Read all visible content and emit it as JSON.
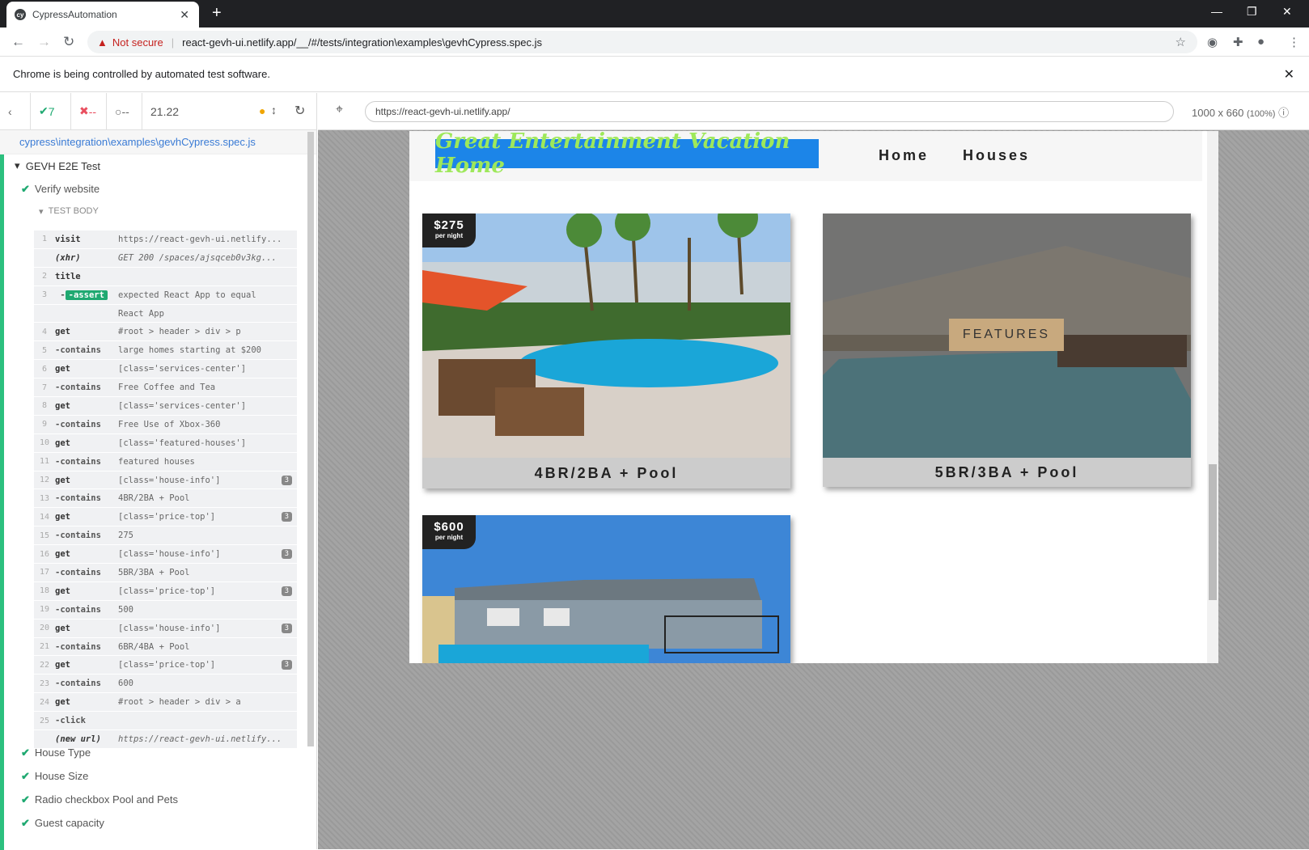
{
  "browser": {
    "tab_title": "CypressAutomation",
    "not_secure": "Not secure",
    "url": "react-gevh-ui.netlify.app/__/#/tests/integration\\examples\\gevhCypress.spec.js",
    "infobar_text": "Chrome is being controlled by automated test software."
  },
  "runner": {
    "passed": "7",
    "failed": "--",
    "pending": "--",
    "duration": "21.22",
    "spec_path": "cypress\\integration\\examples\\gevhCypress.spec.js",
    "suite_title": "GEVH E2E Test",
    "active_test": "Verify website",
    "test_body_label": "TEST BODY",
    "commands": [
      {
        "num": "1",
        "name": "visit",
        "msg": "https://react-gevh-ui.netlify..."
      },
      {
        "num": "",
        "name": "(xhr)",
        "msg": "GET 200 /spaces/ajsqceb0v3kg..."
      },
      {
        "num": "2",
        "name": "title",
        "msg": ""
      },
      {
        "num": "3",
        "name": "-assert",
        "msg": "expected React App to equal"
      },
      {
        "num": "",
        "name": "",
        "msg": "React App"
      },
      {
        "num": "4",
        "name": "get",
        "msg": "#root > header > div > p"
      },
      {
        "num": "5",
        "name": "-contains",
        "msg": "large homes starting at $200"
      },
      {
        "num": "6",
        "name": "get",
        "msg": "[class='services-center']"
      },
      {
        "num": "7",
        "name": "-contains",
        "msg": "Free Coffee and Tea"
      },
      {
        "num": "8",
        "name": "get",
        "msg": "[class='services-center']"
      },
      {
        "num": "9",
        "name": "-contains",
        "msg": "Free Use of Xbox-360"
      },
      {
        "num": "10",
        "name": "get",
        "msg": "[class='featured-houses']"
      },
      {
        "num": "11",
        "name": "-contains",
        "msg": "featured houses"
      },
      {
        "num": "12",
        "name": "get",
        "msg": "[class='house-info']",
        "badge": "3"
      },
      {
        "num": "13",
        "name": "-contains",
        "msg": "4BR/2BA + Pool"
      },
      {
        "num": "14",
        "name": "get",
        "msg": "[class='price-top']",
        "badge": "3"
      },
      {
        "num": "15",
        "name": "-contains",
        "msg": "275"
      },
      {
        "num": "16",
        "name": "get",
        "msg": "[class='house-info']",
        "badge": "3"
      },
      {
        "num": "17",
        "name": "-contains",
        "msg": "5BR/3BA + Pool"
      },
      {
        "num": "18",
        "name": "get",
        "msg": "[class='price-top']",
        "badge": "3"
      },
      {
        "num": "19",
        "name": "-contains",
        "msg": "500"
      },
      {
        "num": "20",
        "name": "get",
        "msg": "[class='house-info']",
        "badge": "3"
      },
      {
        "num": "21",
        "name": "-contains",
        "msg": "6BR/4BA + Pool"
      },
      {
        "num": "22",
        "name": "get",
        "msg": "[class='price-top']",
        "badge": "3"
      },
      {
        "num": "23",
        "name": "-contains",
        "msg": "600"
      },
      {
        "num": "24",
        "name": "get",
        "msg": "#root > header > div > a"
      },
      {
        "num": "25",
        "name": "-click",
        "msg": ""
      },
      {
        "num": "",
        "name": "(new url)",
        "msg": "https://react-gevh-ui.netlify..."
      }
    ],
    "other_tests": [
      "House Type",
      "House Size",
      "Radio checkbox Pool and Pets",
      "Guest capacity"
    ]
  },
  "aut": {
    "url": "https://react-gevh-ui.netlify.app/",
    "viewport": "1000 x 660",
    "zoom": "(100%)",
    "logo_text": "Great Entertainment Vacation Home",
    "nav": [
      "Home",
      "Houses"
    ],
    "cards": [
      {
        "price": "$275",
        "per": "per night",
        "label": "4BR/2BA + Pool"
      },
      {
        "price": "",
        "per": "",
        "label": "5BR/3BA + Pool",
        "hover": "FEATURES"
      },
      {
        "price": "$600",
        "per": "per night",
        "label": ""
      }
    ]
  }
}
